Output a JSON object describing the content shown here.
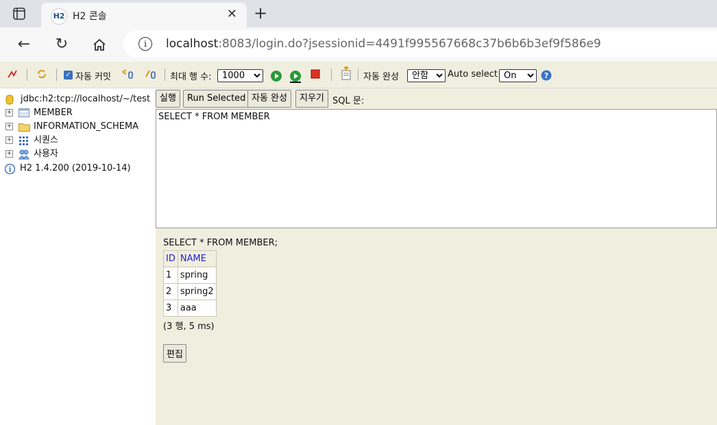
{
  "browser": {
    "tab_title": "H2 콘솔",
    "favicon_text": "H2",
    "url_host": "localhost",
    "url_rest": ":8083/login.do?jsessionid=4491f995567668c37b6b6b3ef9f586e9"
  },
  "toolbar": {
    "auto_commit_label": "자동 커밋",
    "max_rows_label": "최대 행 수:",
    "max_rows_value": "1000",
    "auto_complete_label": "자동 완성",
    "auto_complete_value": "안함",
    "auto_select_label": "Auto select",
    "auto_select_value": "On"
  },
  "tree": {
    "connection": "jdbc:h2:tcp://localhost/~/test",
    "items": [
      {
        "label": "MEMBER"
      },
      {
        "label": "INFORMATION_SCHEMA"
      },
      {
        "label": "시퀀스"
      },
      {
        "label": "사용자"
      }
    ],
    "version": "H2 1.4.200 (2019-10-14)"
  },
  "buttons": {
    "run": "실행",
    "run_selected": "Run Selected",
    "auto_complete": "자동 완성",
    "clear": "지우기",
    "sql_label": "SQL 문:"
  },
  "editor": {
    "text": "SELECT * FROM MEMBER"
  },
  "result": {
    "sql": "SELECT * FROM MEMBER;",
    "columns": [
      "ID",
      "NAME"
    ],
    "rows": [
      [
        "1",
        "spring"
      ],
      [
        "2",
        "spring2"
      ],
      [
        "3",
        "aaa"
      ]
    ],
    "row_count": "(3 행, 5 ms)",
    "edit_label": "편집"
  }
}
